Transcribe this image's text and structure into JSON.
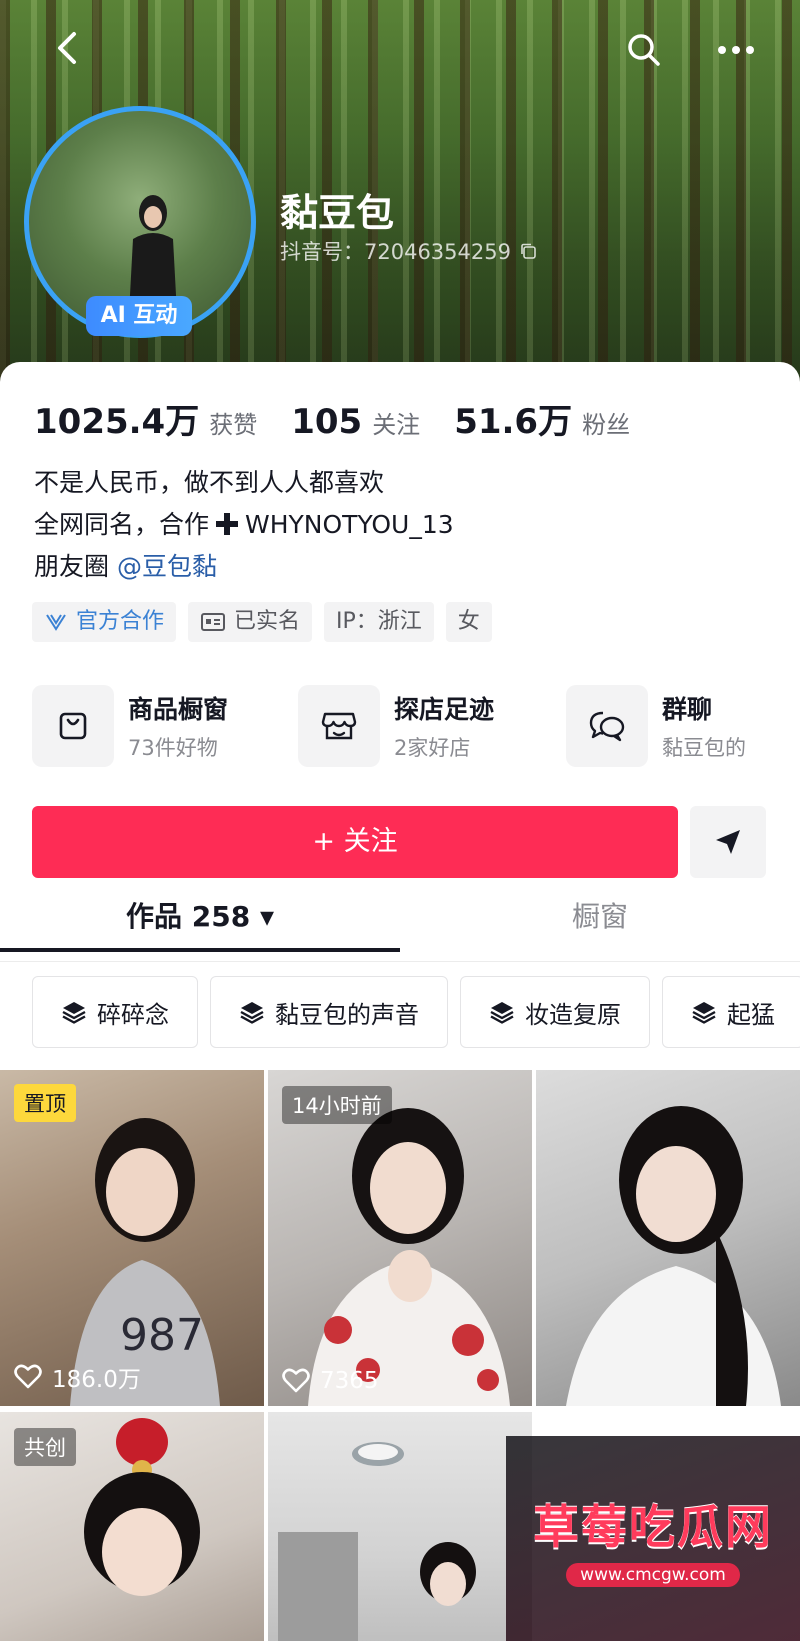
{
  "profile": {
    "name": "黏豆包",
    "id_text": "抖音号：72046354259",
    "ai_badge": "AI 互动"
  },
  "stats": [
    {
      "value": "1025.4万",
      "label": "获赞"
    },
    {
      "value": "105",
      "label": "关注"
    },
    {
      "value": "51.6万",
      "label": "粉丝"
    }
  ],
  "bio": {
    "line1": "不是人民币，做不到人人都喜欢",
    "line2_prefix": "全网同名，合作",
    "line2_suffix": "WHYNOTYOU_13",
    "line3_prefix": "朋友圈",
    "line3_mention": "@豆包黏"
  },
  "tags": {
    "official": "官方合作",
    "verified": "已实名",
    "ip": "IP：浙江",
    "gender": "女"
  },
  "shortcuts": [
    {
      "title": "商品橱窗",
      "sub": "73件好物",
      "icon": "shopping-bag-icon"
    },
    {
      "title": "探店足迹",
      "sub": "2家好店",
      "icon": "store-icon"
    },
    {
      "title": "群聊",
      "sub": "黏豆包的",
      "icon": "chat-bubbles-icon"
    }
  ],
  "actions": {
    "follow": "+ 关注"
  },
  "tabs": {
    "works": "作品 258 ▾",
    "showcase": "橱窗"
  },
  "collections": [
    "碎碎念",
    "黏豆包的声音",
    "妆造复原",
    "起猛"
  ],
  "videos": [
    {
      "badge": "置顶",
      "likes": "186.0万"
    },
    {
      "badge": "14小时前",
      "likes": "7365"
    },
    {
      "badge": "",
      "likes": ""
    },
    {
      "badge": "共创",
      "likes": ""
    }
  ],
  "watermark": {
    "title": "草莓吃瓜网",
    "url": "www.cmcgw.com"
  },
  "colors": {
    "accent": "#fe2c55",
    "ring": "#3aa2f5",
    "mention": "#2a5ea8",
    "pin_badge": "#fdd83c"
  }
}
